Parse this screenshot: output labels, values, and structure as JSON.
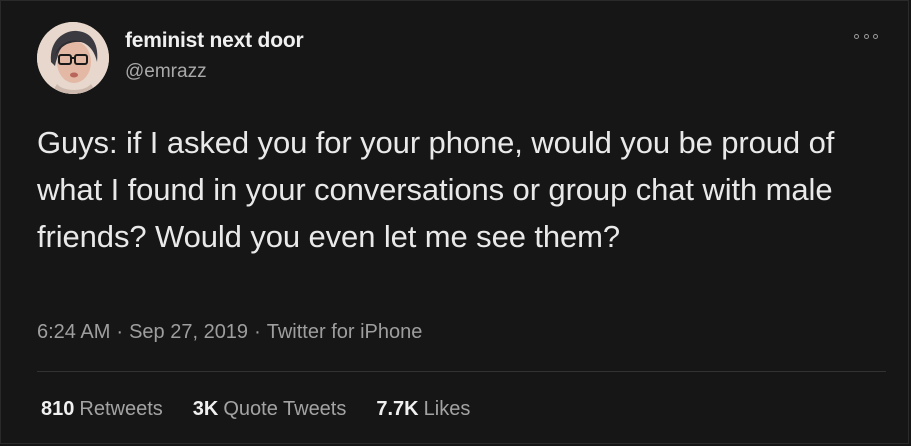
{
  "tweet": {
    "author": {
      "display_name": "feminist next door",
      "handle": "@emrazz"
    },
    "text": "Guys: if I asked you for your phone, would you be proud of what I found in your conversations or group chat with male friends? Would you even let me see them?",
    "meta": {
      "time": "6:24 AM",
      "date": "Sep 27, 2019",
      "source": "Twitter for iPhone",
      "separator": "·"
    },
    "stats": {
      "retweets_count": "810",
      "retweets_label": "Retweets",
      "quotes_count": "3K",
      "quotes_label": "Quote Tweets",
      "likes_count": "7.7K",
      "likes_label": "Likes"
    },
    "icons": {
      "more": "more-options-icon"
    }
  },
  "colors": {
    "background": "#161616",
    "text_primary": "#e9e9e9",
    "text_secondary": "#9e9e9e",
    "divider": "#323232"
  }
}
